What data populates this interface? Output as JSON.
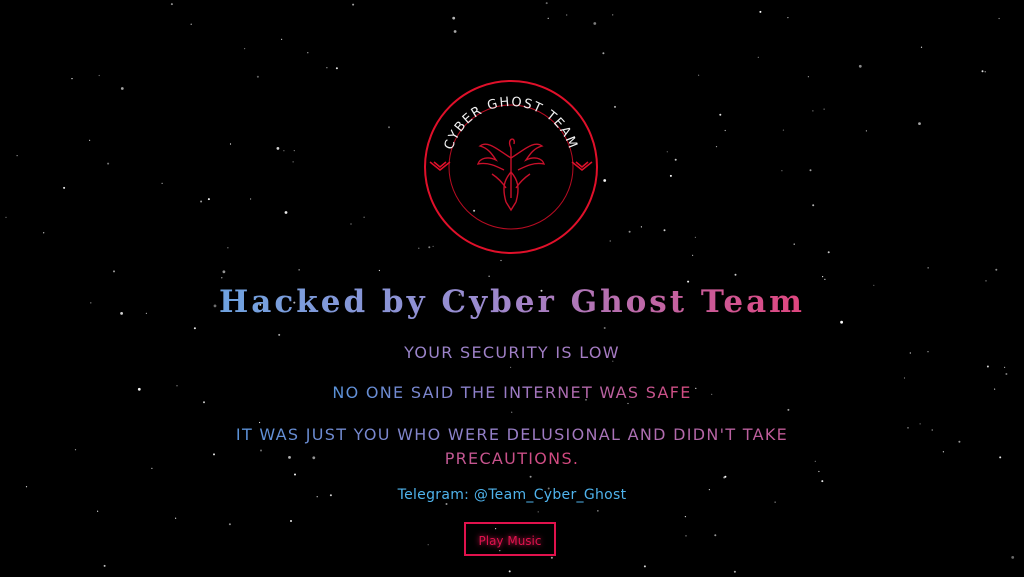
{
  "logo": {
    "ring_text": "CYBER GHOST TEAM",
    "icon": "phoenix-icon",
    "color": "#e0102a"
  },
  "title": "Hacked by Cyber Ghost Team",
  "messages": [
    "YOUR SECURITY IS LOW",
    "NO ONE SAID THE INTERNET WAS SAFE",
    "IT WAS JUST YOU WHO WERE DELUSIONAL AND DIDN'T TAKE PRECAUTIONS."
  ],
  "telegram": "Telegram: @Team_Cyber_Ghost",
  "play_button": "Play Music",
  "colors": {
    "background": "#000000",
    "accent": "#e0124d",
    "link": "#4fb3ec",
    "gradient_start": "#6fa3e0",
    "gradient_end": "#e0457e"
  }
}
